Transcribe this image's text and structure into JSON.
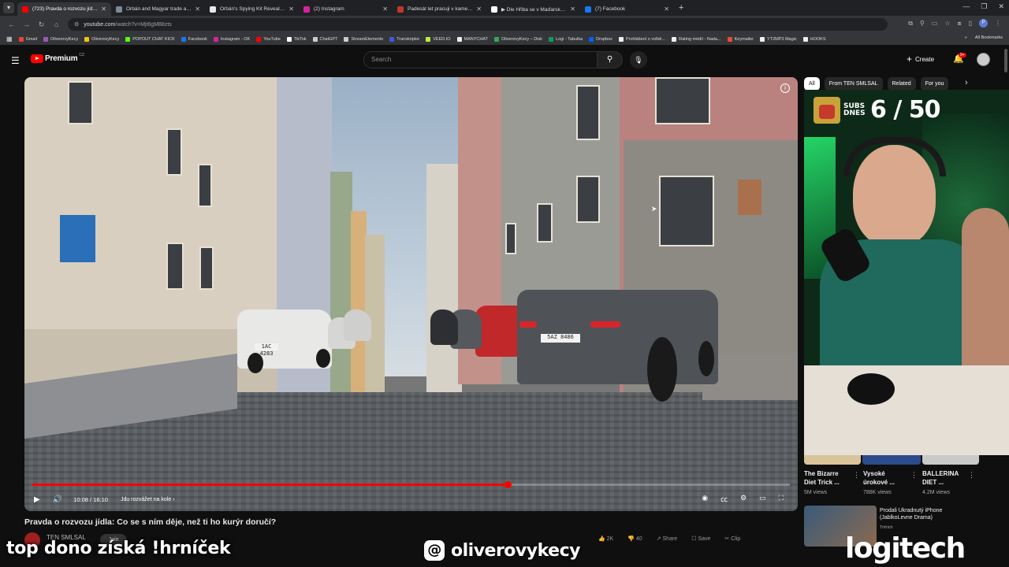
{
  "browser": {
    "tabs": [
      {
        "title": "(723) Pravda o rozvozu jídla: Co",
        "favicon_color": "#ff0000",
        "active": true
      },
      {
        "title": "Orbán and Magyar trade accus",
        "favicon_color": "#7a8a99",
        "active": false
      },
      {
        "title": "Orbán's Spying Kit Revealed: Is",
        "favicon_color": "#e8e8e8",
        "active": false
      },
      {
        "title": "(2) Instagram",
        "favicon_color": "#d6249f",
        "active": false
      },
      {
        "title": "Padesát let pracuji v kamenolo",
        "favicon_color": "#c0392b",
        "active": false
      },
      {
        "title": "▶ Dle Hřiba se v Maďarsku hra",
        "favicon_color": "#ffffff",
        "active": false
      },
      {
        "title": "(7) Facebook",
        "favicon_color": "#1877f2",
        "active": false
      }
    ],
    "url_host": "youtube.com",
    "url_path": "/watch?v=Mjt6gM88zts",
    "bookmarks": [
      {
        "label": "Gmail",
        "color": "#ea4335"
      },
      {
        "label": "OliverovyKecy",
        "color": "#9b59b6"
      },
      {
        "label": "OliverovyKecy",
        "color": "#f1c40f"
      },
      {
        "label": "POPOUT CHAT KICK",
        "color": "#53fc18"
      },
      {
        "label": "Facebook",
        "color": "#1877f2"
      },
      {
        "label": "Instagram - OK",
        "color": "#d6249f"
      },
      {
        "label": "YouTube",
        "color": "#ff0000"
      },
      {
        "label": "TikTok",
        "color": "#ffffff"
      },
      {
        "label": "ChatGPT",
        "color": "#cccccc"
      },
      {
        "label": "StreamElements",
        "color": "#cccccc"
      },
      {
        "label": "Transkriptor",
        "color": "#3b5bdb"
      },
      {
        "label": "VEED.IO",
        "color": "#b5f23d"
      },
      {
        "label": "MANYCHAT",
        "color": "#eeeeee"
      },
      {
        "label": "OliverovyKecy – Disk",
        "color": "#34a853"
      },
      {
        "label": "Logi - Tabulka",
        "color": "#0f9d58"
      },
      {
        "label": "Dropbox",
        "color": "#0061ff"
      },
      {
        "label": "Prohlášení o volbě...",
        "color": "#eeeeee"
      },
      {
        "label": "Rating médií - Nada...",
        "color": "#eeeeee"
      },
      {
        "label": "Keymailer",
        "color": "#e74c3c"
      },
      {
        "label": "YT2MP3 Magic",
        "color": "#eeeeee"
      },
      {
        "label": "HOOKS",
        "color": "#eeeeee"
      }
    ],
    "all_bookmarks": "All Bookmarks",
    "profile_letter": "P"
  },
  "youtube": {
    "logo": "Premium",
    "region": "CZ",
    "search_placeholder": "Search",
    "create_label": "Create",
    "notif_badge": "9+",
    "player": {
      "current_time": "10:08",
      "duration": "16:10",
      "time_display": "10:08 / 16:10",
      "progress": 0.627,
      "chapter": "Jdu rozvážet na kole",
      "plates": [
        "1AC 4283",
        "5AZ 8486"
      ]
    },
    "video_title": "Pravda o rozvozu jídla: Co se s ním děje, než ti ho kurýr doručí?",
    "channel_name": "TEN SMLSAL",
    "join_label": "Join",
    "actions": [
      "2K",
      "40",
      "Share",
      "Save",
      "Clip"
    ],
    "chips": [
      "All",
      "From TEN SMLSAL",
      "Related",
      "For you"
    ],
    "recommendations": [
      {
        "title": "The Bizarre Diet Trick ...",
        "views": "5M views"
      },
      {
        "title": "Vysoké úrokové ...",
        "views": "788K views"
      },
      {
        "title": "BALLERINA DIET ...",
        "views": "4.2M views"
      }
    ],
    "rec4": {
      "title": "Prodali Ukradnutý iPhone (JablkoLevne Drama)",
      "channel": "Tritrich"
    }
  },
  "stream_overlay": {
    "subs_label": "SUBS DNES",
    "subs_count": "6 / 50",
    "bottom_left": "top dono získá !hrníček",
    "handle": "oliverovykecy",
    "brand": "logitech"
  },
  "colors": {
    "accent_red": "#ff0000",
    "bg": "#0f0f0f"
  }
}
